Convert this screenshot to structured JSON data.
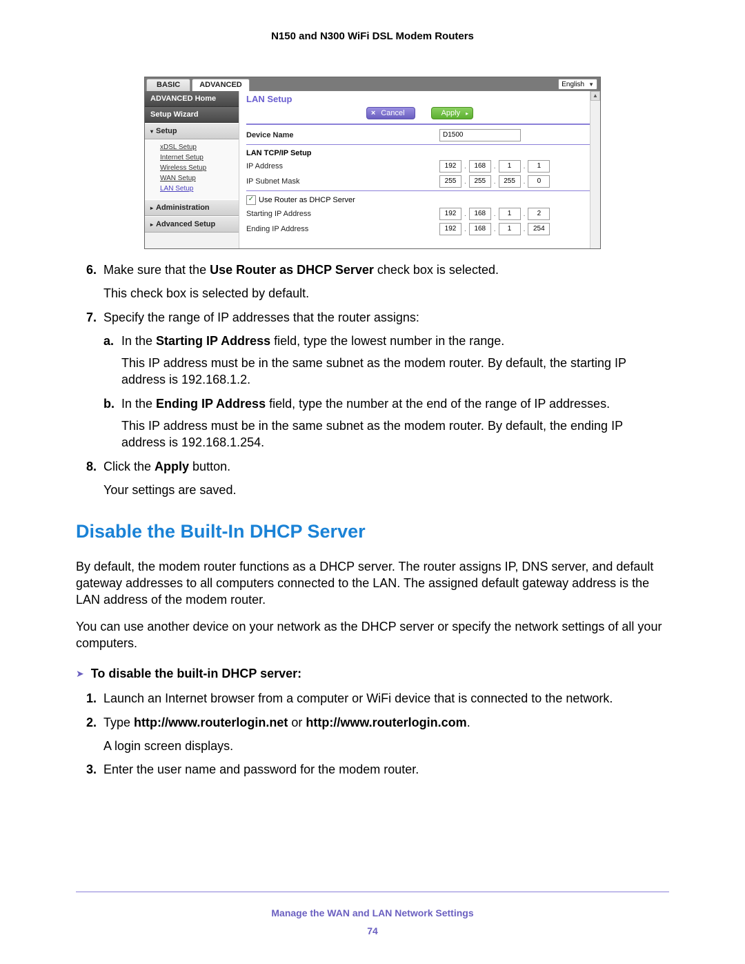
{
  "header_title": "N150 and N300 WiFi DSL Modem Routers",
  "screenshot": {
    "tab_basic": "BASIC",
    "tab_advanced": "ADVANCED",
    "language": "English",
    "sidebar": {
      "advanced_home": "ADVANCED Home",
      "setup_wizard": "Setup Wizard",
      "setup": "Setup",
      "setup_items": {
        "xdsl": "xDSL Setup",
        "internet": "Internet Setup",
        "wireless": "Wireless Setup",
        "wan": "WAN Setup",
        "lan": "LAN Setup"
      },
      "administration": "Administration",
      "advanced_setup": "Advanced Setup"
    },
    "content": {
      "title": "LAN Setup",
      "cancel": "Cancel",
      "apply": "Apply",
      "device_name_label": "Device Name",
      "device_name_value": "D1500",
      "lan_tcpip": "LAN TCP/IP Setup",
      "ip_address_label": "IP Address",
      "ip_address": [
        "192",
        "168",
        "1",
        "1"
      ],
      "subnet_label": "IP Subnet Mask",
      "subnet": [
        "255",
        "255",
        "255",
        "0"
      ],
      "use_router_dhcp": "Use Router as DHCP Server",
      "start_ip_label": "Starting IP Address",
      "start_ip": [
        "192",
        "168",
        "1",
        "2"
      ],
      "end_ip_label": "Ending IP Address",
      "end_ip": [
        "192",
        "168",
        "1",
        "254"
      ]
    }
  },
  "steps": {
    "s6": {
      "num": "6.",
      "text_pre": "Make sure that the ",
      "bold": "Use Router as DHCP Server",
      "text_post": " check box is selected.",
      "note": "This check box is selected by default."
    },
    "s7": {
      "num": "7.",
      "text": "Specify the range of IP addresses that the router assigns:",
      "a": {
        "num": "a.",
        "pre": "In the ",
        "bold": "Starting IP Address",
        "post": " field, type the lowest number in the range.",
        "note": "This IP address must be in the same subnet as the modem router. By default, the starting IP address is 192.168.1.2."
      },
      "b": {
        "num": "b.",
        "pre": "In the ",
        "bold": "Ending IP Address",
        "post": " field, type the number at the end of the range of IP addresses.",
        "note": "This IP address must be in the same subnet as the modem router. By default, the ending IP address is 192.168.1.254."
      }
    },
    "s8": {
      "num": "8.",
      "pre": "Click the ",
      "bold": "Apply",
      "post": " button.",
      "note": "Your settings are saved."
    }
  },
  "section_heading": "Disable the Built-In DHCP Server",
  "para1": "By default, the modem router functions as a DHCP server. The router assigns IP, DNS server, and default gateway addresses to all computers connected to the LAN. The assigned default gateway address is the LAN address of the modem router.",
  "para2": "You can use another device on your network as the DHCP server or specify the network settings of all your computers.",
  "proc_head": "To disable the built-in DHCP server:",
  "proc": {
    "p1": {
      "num": "1.",
      "text": "Launch an Internet browser from a computer or WiFi device that is connected to the network."
    },
    "p2": {
      "num": "2.",
      "pre": "Type ",
      "b1": "http://www.routerlogin.net",
      "mid": " or ",
      "b2": "http://www.routerlogin.com",
      "post": ".",
      "note": "A login screen displays."
    },
    "p3": {
      "num": "3.",
      "text": "Enter the user name and password for the modem router."
    }
  },
  "footer_title": "Manage the WAN and LAN Network Settings",
  "page_number": "74"
}
